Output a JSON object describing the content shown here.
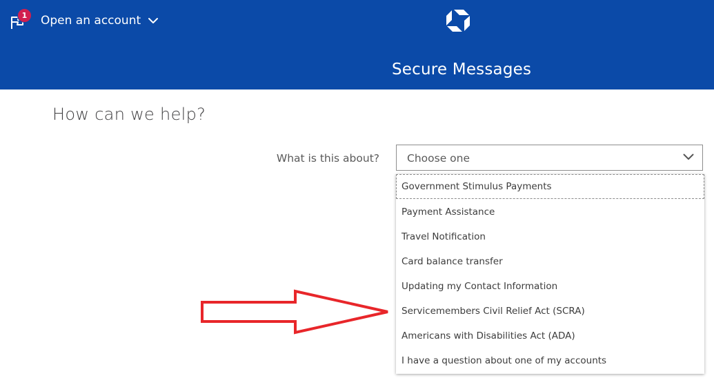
{
  "header": {
    "notification_count": "1",
    "open_account_label": "Open an account",
    "page_title": "Secure Messages",
    "background_color": "#0b4aa8",
    "badge_color": "#d11f4f",
    "icons": {
      "notification": "flag-notification-icon",
      "open_account_chevron": "chevron-down-icon",
      "logo": "chase-octagon-logo"
    }
  },
  "main": {
    "title": "How can we help?",
    "form": {
      "label": "What is this about?",
      "select": {
        "value": "Choose one",
        "chevron_icon": "chevron-down-icon",
        "options": [
          "Government Stimulus Payments",
          "Payment Assistance",
          "Travel Notification",
          "Card balance transfer",
          "Updating my Contact Information",
          "Servicemembers Civil Relief Act (SCRA)",
          "Americans with Disabilities Act (ADA)",
          "I have a question about one of my accounts"
        ]
      }
    }
  },
  "annotation": {
    "icon": "red-arrow-right-icon",
    "color": "#e8262a"
  }
}
